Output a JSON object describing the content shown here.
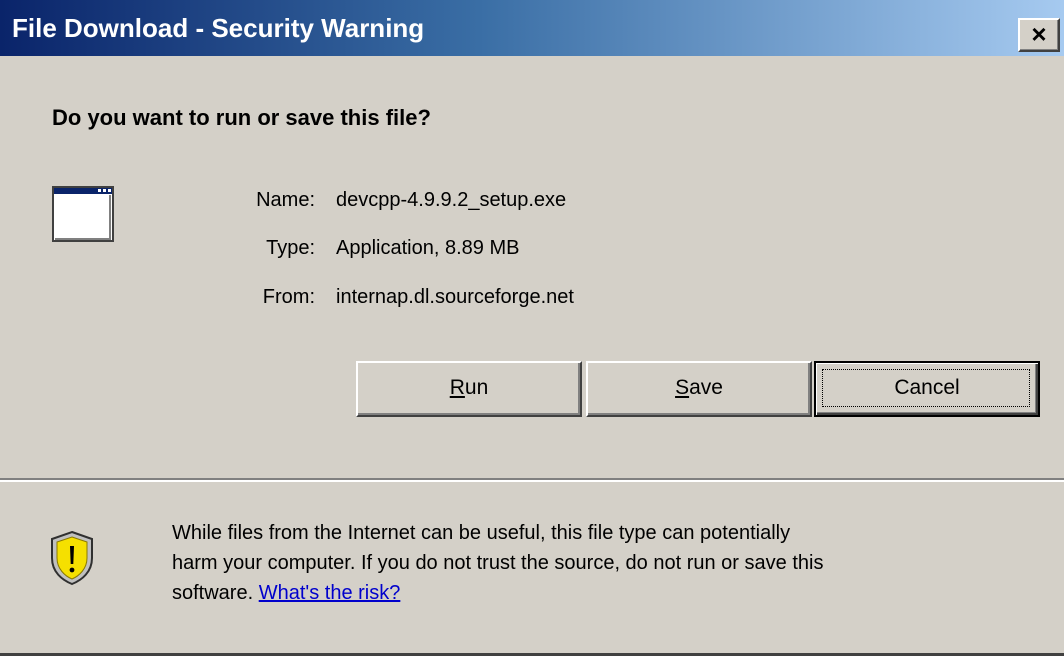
{
  "dialog": {
    "title": "File Download - Security Warning",
    "close_glyph": "×"
  },
  "question": "Do you want to run or save this file?",
  "file_info": {
    "icon": "application-window-icon",
    "name_label": "Name:",
    "name_value": "devcpp-4.9.9.2_setup.exe",
    "type_label": "Type:",
    "type_value": "Application, 8.89 MB",
    "from_label": "From:",
    "from_value": "internap.dl.sourceforge.net"
  },
  "buttons": {
    "run_accel": "R",
    "run_rest": "un",
    "save_accel": "S",
    "save_rest": "ave",
    "cancel_label": "Cancel"
  },
  "warning": {
    "icon": "security-shield-icon",
    "line1": "While files from the Internet can be useful, this file type can potentially",
    "line2": "harm your computer. If you do not trust the source, do not run or save this",
    "line3_prefix": "software. ",
    "risk_link": "What's the risk?"
  },
  "colors": {
    "titlebar_start": "#0a246a",
    "titlebar_end": "#a6caf0",
    "dialog_background": "#d4d0c8",
    "link": "#0000cc",
    "shield_yellow": "#f5e000"
  }
}
